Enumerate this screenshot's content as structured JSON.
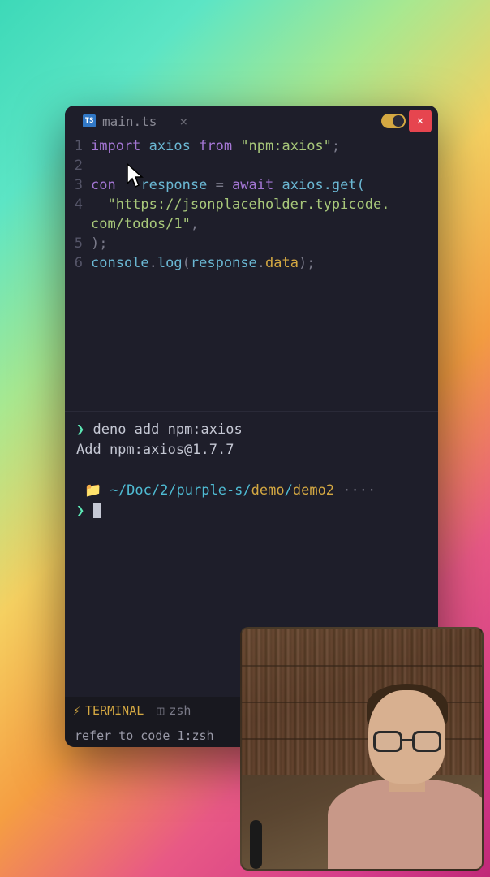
{
  "tab": {
    "filename": "main.ts",
    "icon_text": "TS"
  },
  "code": {
    "lines": [
      {
        "num": "1"
      },
      {
        "num": "2"
      },
      {
        "num": "3"
      },
      {
        "num": "4"
      },
      {
        "num": "5"
      },
      {
        "num": "6"
      }
    ],
    "tokens": {
      "import": "import",
      "axios": "axios",
      "from": "from",
      "npm_axios_str": "\"npm:axios\"",
      "semi": ";",
      "con": "con",
      "response": "response",
      "equals": " = ",
      "await": "await",
      "axios_get": " axios.get(",
      "url_line1": "\"https://jsonplaceholder.typicode.",
      "url_line2": "com/todos/1\"",
      "comma": ",",
      "close_paren": ");",
      "console": "console",
      "dot": ".",
      "log": "log",
      "open_p": "(",
      "resp_var": "response",
      "data": "data",
      "close_call": ");"
    }
  },
  "terminal": {
    "cmd_prefix": "❯",
    "cmd": " deno add npm:axios",
    "output": "Add npm:axios@1.7.7",
    "apple": "",
    "folder": "📁",
    "path_prefix": " ~/Doc/2/purple-s/",
    "path_demo": "demo",
    "path_slash": "/",
    "path_demo2": "demo2",
    "dots": " ····"
  },
  "statusbar": {
    "terminal_icon": "⚡",
    "terminal_label": "TERMINAL",
    "shell_icon": "◫",
    "shell_label": "zsh"
  },
  "footer": {
    "text": "refer to code 1:zsh"
  }
}
